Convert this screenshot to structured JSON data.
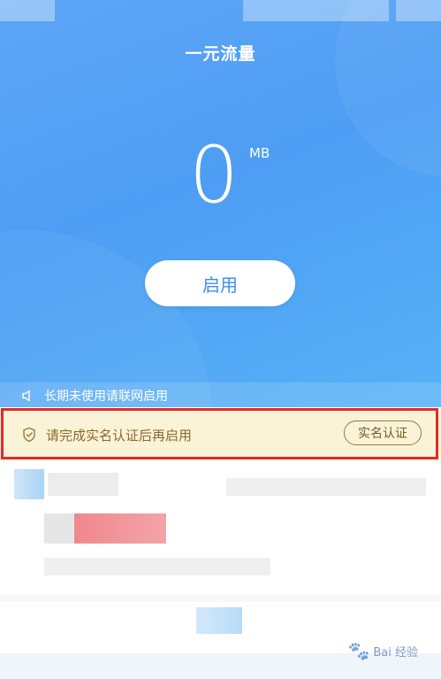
{
  "header": {
    "title": "一元流量"
  },
  "balance": {
    "value": "0",
    "unit": "MB"
  },
  "actions": {
    "enable_label": "启用"
  },
  "notice": {
    "text": "长期未使用请联网启用",
    "icon": "speaker-icon"
  },
  "verification": {
    "message": "请完成实名认证后再启用",
    "button_label": "实名认证",
    "icon": "shield-check-icon"
  },
  "watermark": {
    "text": "Bai 经验"
  },
  "colors": {
    "hero_blue": "#4d9df4",
    "banner_bg": "#fbf3d8",
    "highlight_red": "#e02a2a",
    "button_text": "#3e8cf0"
  }
}
